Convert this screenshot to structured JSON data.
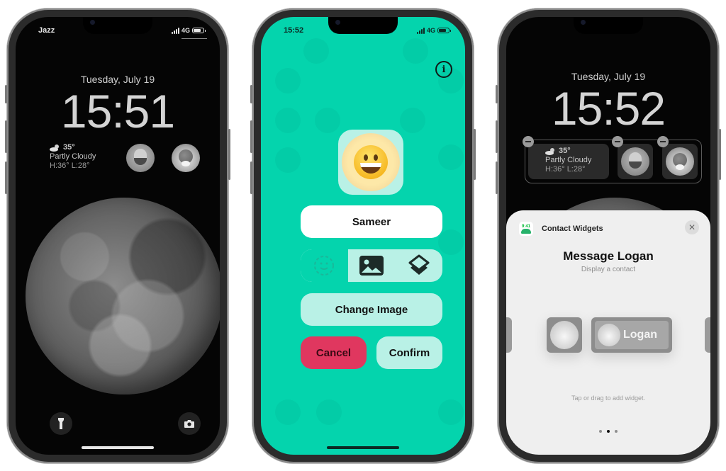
{
  "phones": [
    {
      "id": "lock-screen",
      "status": {
        "carrier": "Jazz",
        "network": "4G"
      },
      "date": "Tuesday, July 19",
      "time": "15:51",
      "weather": {
        "icon": "partly-cloudy-icon",
        "temp": "35°",
        "condition": "Partly Cloudy",
        "hilo": "H:36° L:28°"
      },
      "contacts": [
        {
          "avatar": "memoji-avatar"
        },
        {
          "avatar": "flower-avatar"
        }
      ],
      "quick_actions": [
        {
          "icon": "flashlight-icon"
        },
        {
          "icon": "camera-icon"
        }
      ],
      "wallpaper": "moon"
    },
    {
      "id": "contact-editor",
      "status": {
        "time": "15:52",
        "network": "4G"
      },
      "background_color": "#04d4ad",
      "info_glyph": "i",
      "emoji": "grinning-face",
      "name_field": {
        "value": "Sameer"
      },
      "segments": [
        {
          "icon": "emoji-picker-icon",
          "selected": true
        },
        {
          "icon": "photo-icon",
          "selected": false
        },
        {
          "icon": "layers-icon",
          "selected": false
        }
      ],
      "buttons": {
        "change_image": "Change Image",
        "cancel": "Cancel",
        "confirm": "Confirm"
      },
      "colors": {
        "cancel": "#e0375f",
        "light": "#b9f1e6"
      }
    },
    {
      "id": "widget-picker",
      "date": "Tuesday, July 19",
      "time": "15:52",
      "weather": {
        "temp": "35°",
        "condition": "Partly Cloudy",
        "hilo": "H:36° L:28°"
      },
      "sheet": {
        "app_icon_text": "9:41",
        "app_name": "Contact Widgets",
        "close_glyph": "✕",
        "title": "Message Logan",
        "subtitle": "Display a contact",
        "wide_preview_label": "Logan",
        "hint": "Tap or drag to add widget.",
        "page_count": 3,
        "current_page": 2
      }
    }
  ]
}
